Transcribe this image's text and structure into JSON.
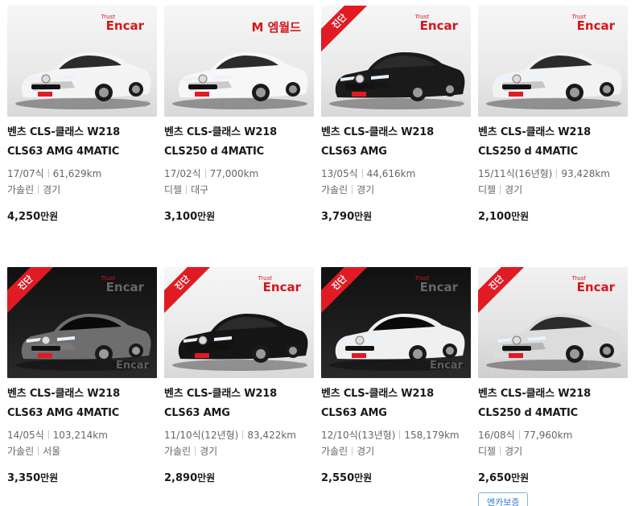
{
  "listings": [
    {
      "title": "벤츠 CLS-클래스 W218 CLS63 AMG 4MATIC",
      "year": "17/07식",
      "mileage": "61,629km",
      "fuel": "가솔린",
      "region": "경기",
      "price": "4,250",
      "price_unit": "만원",
      "diagnosed": false,
      "brand_text": "Encar",
      "brand_sub": "Trust",
      "watermark": "Encar",
      "theme": "light",
      "car_color": "#f4f4f4"
    },
    {
      "title": "벤츠 CLS-클래스 W218 CLS250 d 4MATIC",
      "year": "17/02식",
      "mileage": "77,000km",
      "fuel": "디젤",
      "region": "대구",
      "price": "3,100",
      "price_unit": "만원",
      "diagnosed": false,
      "brand_text": "M 엠월드",
      "brand_sub": "",
      "watermark": "",
      "theme": "light",
      "car_color": "#f7f7f7"
    },
    {
      "title": "벤츠 CLS-클래스 W218 CLS63 AMG",
      "year": "13/05식",
      "mileage": "44,616km",
      "fuel": "가솔린",
      "region": "경기",
      "price": "3,790",
      "price_unit": "만원",
      "diagnosed": true,
      "ribbon_text": "진단",
      "brand_text": "Encar",
      "brand_sub": "Trust",
      "watermark": "Encar",
      "theme": "light",
      "car_color": "#1a1a1a"
    },
    {
      "title": "벤츠 CLS-클래스 W218 CLS250 d 4MATIC",
      "year": "15/11식(16년형)",
      "mileage": "93,428km",
      "fuel": "디젤",
      "region": "경기",
      "price": "2,100",
      "price_unit": "만원",
      "diagnosed": false,
      "brand_text": "Encar",
      "brand_sub": "Trust",
      "watermark": "Encar",
      "theme": "light",
      "car_color": "#f2f2f2"
    },
    {
      "title": "벤츠 CLS-클래스 W218 CLS63 AMG 4MATIC",
      "year": "14/05식",
      "mileage": "103,214km",
      "fuel": "가솔린",
      "region": "서울",
      "price": "3,350",
      "price_unit": "만원",
      "diagnosed": true,
      "ribbon_text": "진단",
      "brand_text": "Encar",
      "brand_sub": "Trust",
      "watermark": "Encar",
      "theme": "dark",
      "car_color": "#6e6e6e"
    },
    {
      "title": "벤츠 CLS-클래스 W218 CLS63 AMG",
      "year": "11/10식(12년형)",
      "mileage": "83,422km",
      "fuel": "가솔린",
      "region": "경기",
      "price": "2,890",
      "price_unit": "만원",
      "diagnosed": true,
      "ribbon_text": "진단",
      "brand_text": "Encar",
      "brand_sub": "Trust",
      "watermark": "Encar",
      "theme": "light",
      "car_color": "#151515"
    },
    {
      "title": "벤츠 CLS-클래스 W218 CLS63 AMG",
      "year": "12/10식(13년형)",
      "mileage": "158,179km",
      "fuel": "가솔린",
      "region": "경기",
      "price": "2,550",
      "price_unit": "만원",
      "diagnosed": true,
      "ribbon_text": "진단",
      "brand_text": "Encar",
      "brand_sub": "Trust",
      "watermark": "Encar",
      "theme": "dark",
      "car_color": "#f0f0f0"
    },
    {
      "title": "벤츠 CLS-클래스 W218 CLS250 d 4MATIC",
      "year": "16/08식",
      "mileage": "77,960km",
      "fuel": "디젤",
      "region": "경기",
      "price": "2,650",
      "price_unit": "만원",
      "diagnosed": true,
      "ribbon_text": "진단",
      "brand_text": "Encar",
      "brand_sub": "Trust",
      "watermark": "Encar",
      "theme": "grey",
      "car_color": "#dcdcdc",
      "badge": "엔카보증"
    }
  ]
}
